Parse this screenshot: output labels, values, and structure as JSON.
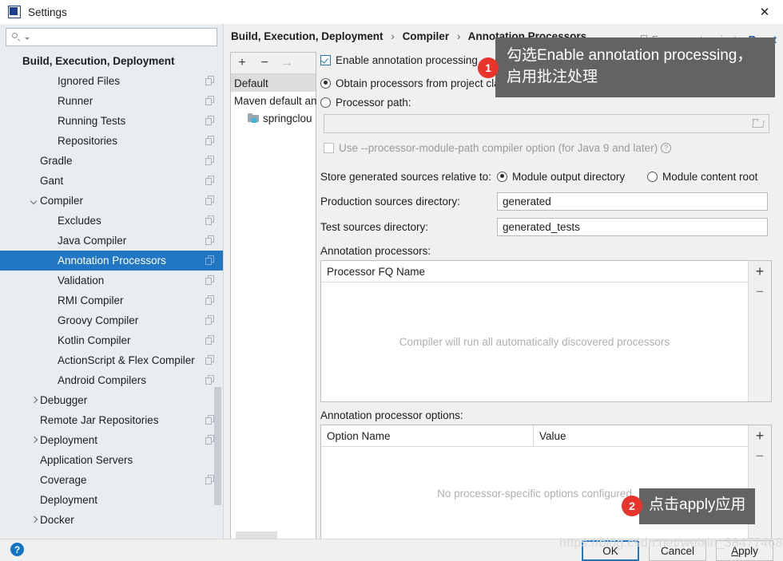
{
  "window": {
    "title": "Settings",
    "logo_icon": "intellij-idea-logo",
    "close_icon": "close-icon"
  },
  "sidebar": {
    "search": {
      "placeholder": "",
      "value": "",
      "icon": "search-icon",
      "caret_icon": "chevron-down-icon"
    },
    "items": [
      {
        "label": "Build, Execution, Deployment",
        "indent": 0,
        "bold": true,
        "arrow": "",
        "badge": false,
        "selected": false
      },
      {
        "label": "Ignored Files",
        "indent": 2,
        "bold": false,
        "arrow": "",
        "badge": true,
        "selected": false
      },
      {
        "label": "Runner",
        "indent": 2,
        "bold": false,
        "arrow": "",
        "badge": true,
        "selected": false
      },
      {
        "label": "Running Tests",
        "indent": 2,
        "bold": false,
        "arrow": "",
        "badge": true,
        "selected": false
      },
      {
        "label": "Repositories",
        "indent": 2,
        "bold": false,
        "arrow": "",
        "badge": true,
        "selected": false
      },
      {
        "label": "Gradle",
        "indent": 1,
        "bold": false,
        "arrow": "",
        "badge": true,
        "selected": false
      },
      {
        "label": "Gant",
        "indent": 1,
        "bold": false,
        "arrow": "",
        "badge": true,
        "selected": false
      },
      {
        "label": "Compiler",
        "indent": 1,
        "bold": false,
        "arrow": "down",
        "badge": true,
        "selected": false
      },
      {
        "label": "Excludes",
        "indent": 2,
        "bold": false,
        "arrow": "",
        "badge": true,
        "selected": false
      },
      {
        "label": "Java Compiler",
        "indent": 2,
        "bold": false,
        "arrow": "",
        "badge": true,
        "selected": false
      },
      {
        "label": "Annotation Processors",
        "indent": 2,
        "bold": false,
        "arrow": "",
        "badge": true,
        "selected": true
      },
      {
        "label": "Validation",
        "indent": 2,
        "bold": false,
        "arrow": "",
        "badge": true,
        "selected": false
      },
      {
        "label": "RMI Compiler",
        "indent": 2,
        "bold": false,
        "arrow": "",
        "badge": true,
        "selected": false
      },
      {
        "label": "Groovy Compiler",
        "indent": 2,
        "bold": false,
        "arrow": "",
        "badge": true,
        "selected": false
      },
      {
        "label": "Kotlin Compiler",
        "indent": 2,
        "bold": false,
        "arrow": "",
        "badge": true,
        "selected": false
      },
      {
        "label": "ActionScript & Flex Compiler",
        "indent": 2,
        "bold": false,
        "arrow": "",
        "badge": true,
        "selected": false
      },
      {
        "label": "Android Compilers",
        "indent": 2,
        "bold": false,
        "arrow": "",
        "badge": true,
        "selected": false
      },
      {
        "label": "Debugger",
        "indent": 1,
        "bold": false,
        "arrow": "right",
        "badge": false,
        "selected": false
      },
      {
        "label": "Remote Jar Repositories",
        "indent": 1,
        "bold": false,
        "arrow": "",
        "badge": true,
        "selected": false
      },
      {
        "label": "Deployment",
        "indent": 1,
        "bold": false,
        "arrow": "right",
        "badge": true,
        "selected": false
      },
      {
        "label": "Application Servers",
        "indent": 1,
        "bold": false,
        "arrow": "",
        "badge": false,
        "selected": false
      },
      {
        "label": "Coverage",
        "indent": 1,
        "bold": false,
        "arrow": "",
        "badge": true,
        "selected": false
      },
      {
        "label": "Deployment",
        "indent": 1,
        "bold": false,
        "arrow": "",
        "badge": false,
        "selected": false
      },
      {
        "label": "Docker",
        "indent": 1,
        "bold": false,
        "arrow": "right",
        "badge": false,
        "selected": false
      }
    ]
  },
  "header": {
    "breadcrumb": [
      "Build, Execution, Deployment",
      "Compiler",
      "Annotation Processors"
    ],
    "separator": "›",
    "for_current_project": "For current project",
    "for_current_project_icon": "copy-module-icon",
    "reset_label": "Reset"
  },
  "profiles": {
    "toolbar": {
      "add_label": "+",
      "remove_label": "−",
      "move_label": "→"
    },
    "items": [
      {
        "label": "Default",
        "type": "profile",
        "selected": true
      },
      {
        "label": "Maven default an",
        "type": "profile",
        "selected": false
      },
      {
        "label": "springclou",
        "type": "module",
        "selected": false
      }
    ]
  },
  "main": {
    "enable_annotation_processing": {
      "label": "Enable annotation processing",
      "checked": true
    },
    "source_mode": {
      "obtain_from_classpath": {
        "label": "Obtain processors from project classpath",
        "checked": true
      },
      "processor_path": {
        "label": "Processor path:",
        "checked": false
      },
      "path_value": "",
      "folder_icon": "folder-browse-icon"
    },
    "processor_module_path": {
      "label": "Use --processor-module-path compiler option (for Java 9 and later)",
      "checked": false,
      "help_icon": "question-mark-icon"
    },
    "store_generated": {
      "label": "Store generated sources relative to:",
      "options": [
        {
          "label": "Module output directory",
          "checked": true
        },
        {
          "label": "Module content root",
          "checked": false
        }
      ]
    },
    "production_sources": {
      "label": "Production sources directory:",
      "value": "generated"
    },
    "test_sources": {
      "label": "Test sources directory:",
      "value": "generated_tests"
    },
    "processors_table": {
      "label": "Annotation processors:",
      "columns": [
        "Processor FQ Name"
      ],
      "empty_text": "Compiler will run all automatically discovered processors",
      "add_label": "+",
      "remove_label": "−"
    },
    "options_table": {
      "label": "Annotation processor options:",
      "columns": [
        "Option Name",
        "Value"
      ],
      "empty_text": "No processor-specific options configured",
      "add_label": "+",
      "remove_label": "−"
    }
  },
  "footer": {
    "help_icon": "help-question-icon",
    "buttons": [
      {
        "label": "OK",
        "primary": true
      },
      {
        "label": "Cancel",
        "primary": false
      },
      {
        "label": "Apply",
        "primary": false,
        "mnemonic": "A"
      }
    ],
    "watermark": "https://blog.csdn.net/weixin_38477468"
  },
  "callouts": [
    {
      "number": "1",
      "text": "勾选Enable  annotation processing，启用批注处理"
    },
    {
      "number": "2",
      "text": "点击apply应用"
    }
  ]
}
